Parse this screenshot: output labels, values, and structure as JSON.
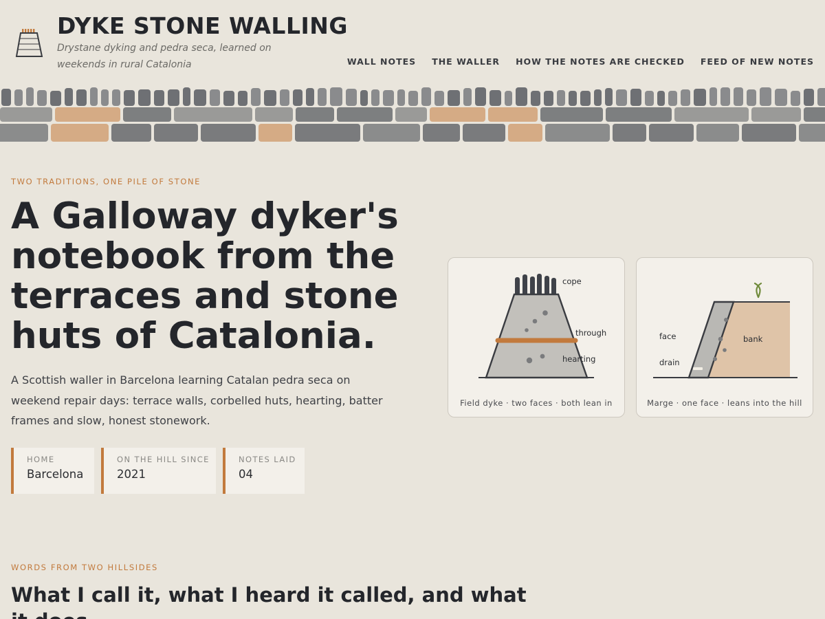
{
  "header": {
    "title": "DYKE STONE WALLING",
    "tagline": "Drystane dyking and pedra seca, learned on weekends in rural Catalonia",
    "logo_icon": "wall-section-icon",
    "nav": [
      {
        "label": "WALL NOTES"
      },
      {
        "label": "THE WALLER"
      },
      {
        "label": "HOW THE NOTES ARE CHECKED"
      },
      {
        "label": "FEED OF NEW NOTES"
      }
    ]
  },
  "colors": {
    "accent": "#c27a3d",
    "background": "#e9e5dc",
    "ink": "#24262b",
    "card": "#f3f0ea",
    "stone_dark": "#7d7f80",
    "stone_light": "#9a9a98",
    "stone_tan": "#d5ab85"
  },
  "hero": {
    "eyebrow": "TWO TRADITIONS, ONE PILE OF STONE",
    "title": "A Galloway dyker's notebook from the terraces and stone huts of Catalonia.",
    "intro": "A Scottish waller in Barcelona learning Catalan pedra seca on weekend repair days: terrace walls, corbelled huts, hearting, batter frames and slow, honest stonework.",
    "stats": [
      {
        "label": "HOME",
        "value": "Barcelona"
      },
      {
        "label": "ON THE HILL SINCE",
        "value": "2021"
      },
      {
        "label": "NOTES LAID",
        "value": "04"
      }
    ]
  },
  "diagrams": {
    "field_dyke": {
      "labels": {
        "cope": "cope",
        "through": "through",
        "hearting": "hearting"
      },
      "caption": "Field dyke · two faces · both lean in"
    },
    "marge": {
      "labels": {
        "face": "face",
        "drain": "drain",
        "bank": "bank"
      },
      "caption": "Marge · one face · leans into the hill"
    }
  },
  "glossary": {
    "eyebrow": "WORDS FROM TWO HILLSIDES",
    "title": "What I call it, what I heard it called, and what it does"
  }
}
